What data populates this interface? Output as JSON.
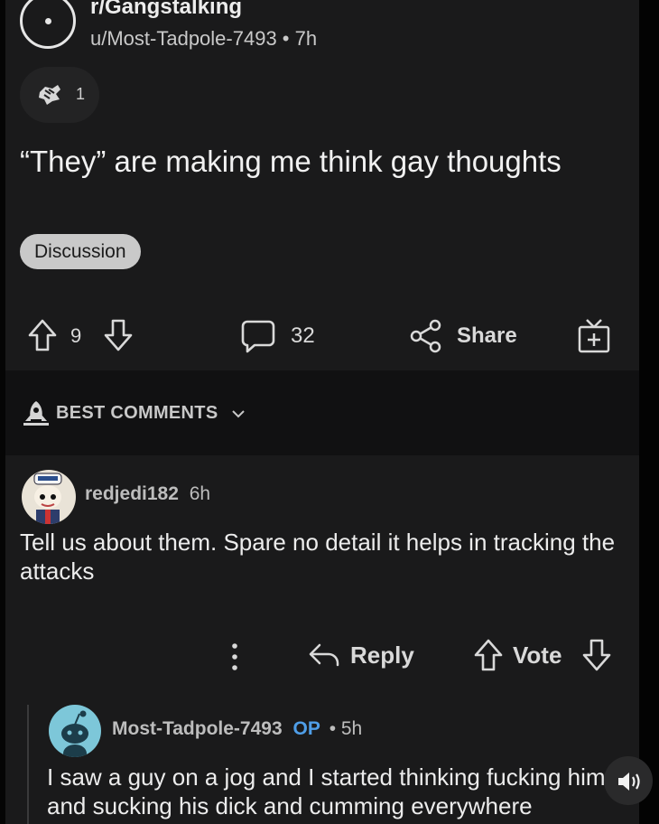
{
  "header": {
    "subreddit": "r/Gangstalking",
    "meta": "u/Most-Tadpole-7493 • 7h"
  },
  "award": {
    "icon": "award-icon",
    "count": "1"
  },
  "post": {
    "title": "“They” are making me think gay thoughts",
    "flair": "Discussion"
  },
  "actions": {
    "upvotes": "9",
    "comments": "32",
    "share_label": "Share"
  },
  "comments_bar": {
    "label": "BEST COMMENTS"
  },
  "comment1": {
    "author": "redjedi182",
    "age": "6h",
    "body": "Tell us about them. Spare no detail it helps in tracking the attacks",
    "reply_label": "Reply",
    "vote_label": "Vote"
  },
  "comment2": {
    "author": "Most-Tadpole-7493",
    "op": "OP",
    "age": "• 5h",
    "body": "I saw a guy on a jog and I started thinking fucking him and sucking his dick and cumming everywhere"
  },
  "colors": {
    "background": "#1a1a1b",
    "op": "#4f9ee8",
    "flair": "#c9c9c9"
  }
}
